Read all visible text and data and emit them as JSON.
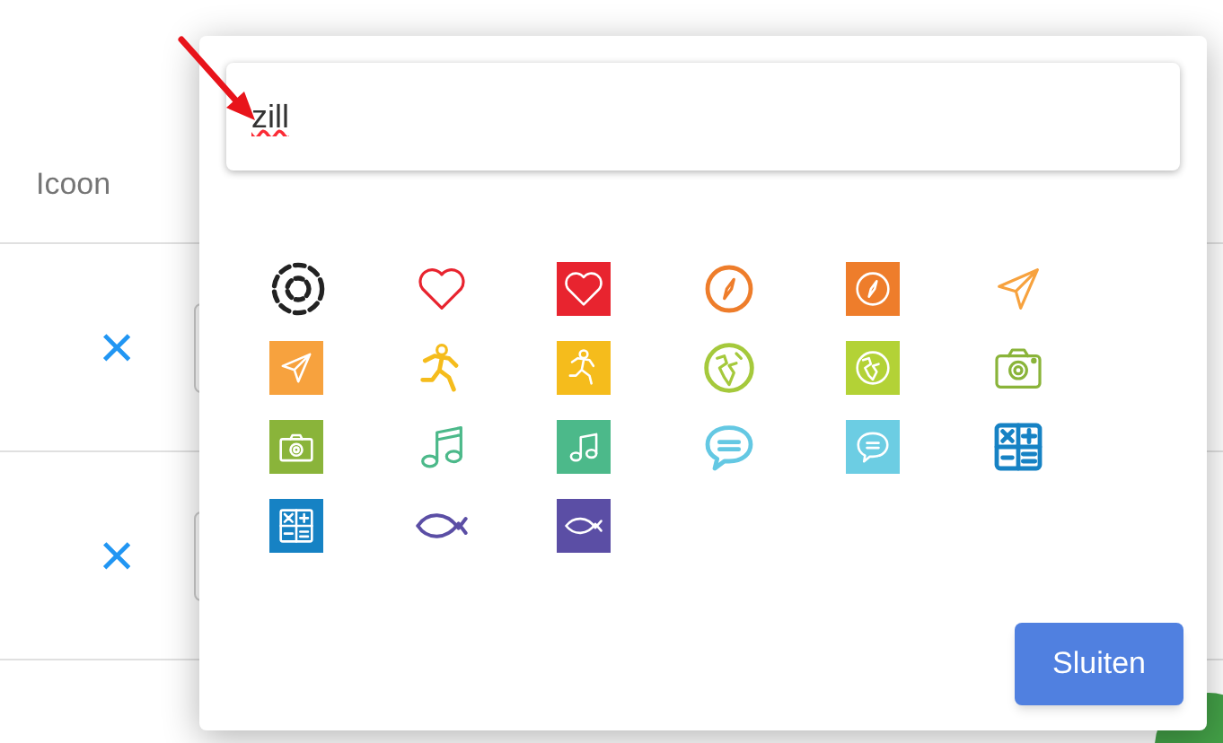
{
  "background": {
    "column_header": "Icoon",
    "rows": [
      {
        "remove": "×"
      },
      {
        "remove": "×"
      }
    ]
  },
  "dialog": {
    "search": {
      "value": "zill",
      "misspelled": true
    },
    "icons": [
      {
        "kind": "outline",
        "color": "#222222"
      },
      {
        "kind": "outline",
        "color": "#e8242f"
      },
      {
        "kind": "tile",
        "color": "#e8242f"
      },
      {
        "kind": "outline",
        "color": "#ee7d2b"
      },
      {
        "kind": "tile",
        "color": "#ee7d2b"
      },
      {
        "kind": "outline",
        "color": "#f7a23e"
      },
      {
        "kind": "tile",
        "color": "#f7a23e"
      },
      {
        "kind": "outline",
        "color": "#f5bc1c"
      },
      {
        "kind": "tile",
        "color": "#f5bc1c"
      },
      {
        "kind": "outline",
        "color": "#a5c93c"
      },
      {
        "kind": "tile",
        "color": "#b3d236"
      },
      {
        "kind": "outline",
        "color": "#8ab43a"
      },
      {
        "kind": "tile",
        "color": "#8ab43a"
      },
      {
        "kind": "outline",
        "color": "#4cb98a"
      },
      {
        "kind": "tile",
        "color": "#4cb98a"
      },
      {
        "kind": "outline",
        "color": "#64c8e3"
      },
      {
        "kind": "tile",
        "color": "#6ccde3"
      },
      {
        "kind": "outline",
        "color": "#1682c4"
      },
      {
        "kind": "tile",
        "color": "#1682c4"
      },
      {
        "kind": "outline",
        "color": "#5b4ea5"
      },
      {
        "kind": "tile",
        "color": "#5b4ea5"
      }
    ],
    "close_button": "Sluiten"
  }
}
